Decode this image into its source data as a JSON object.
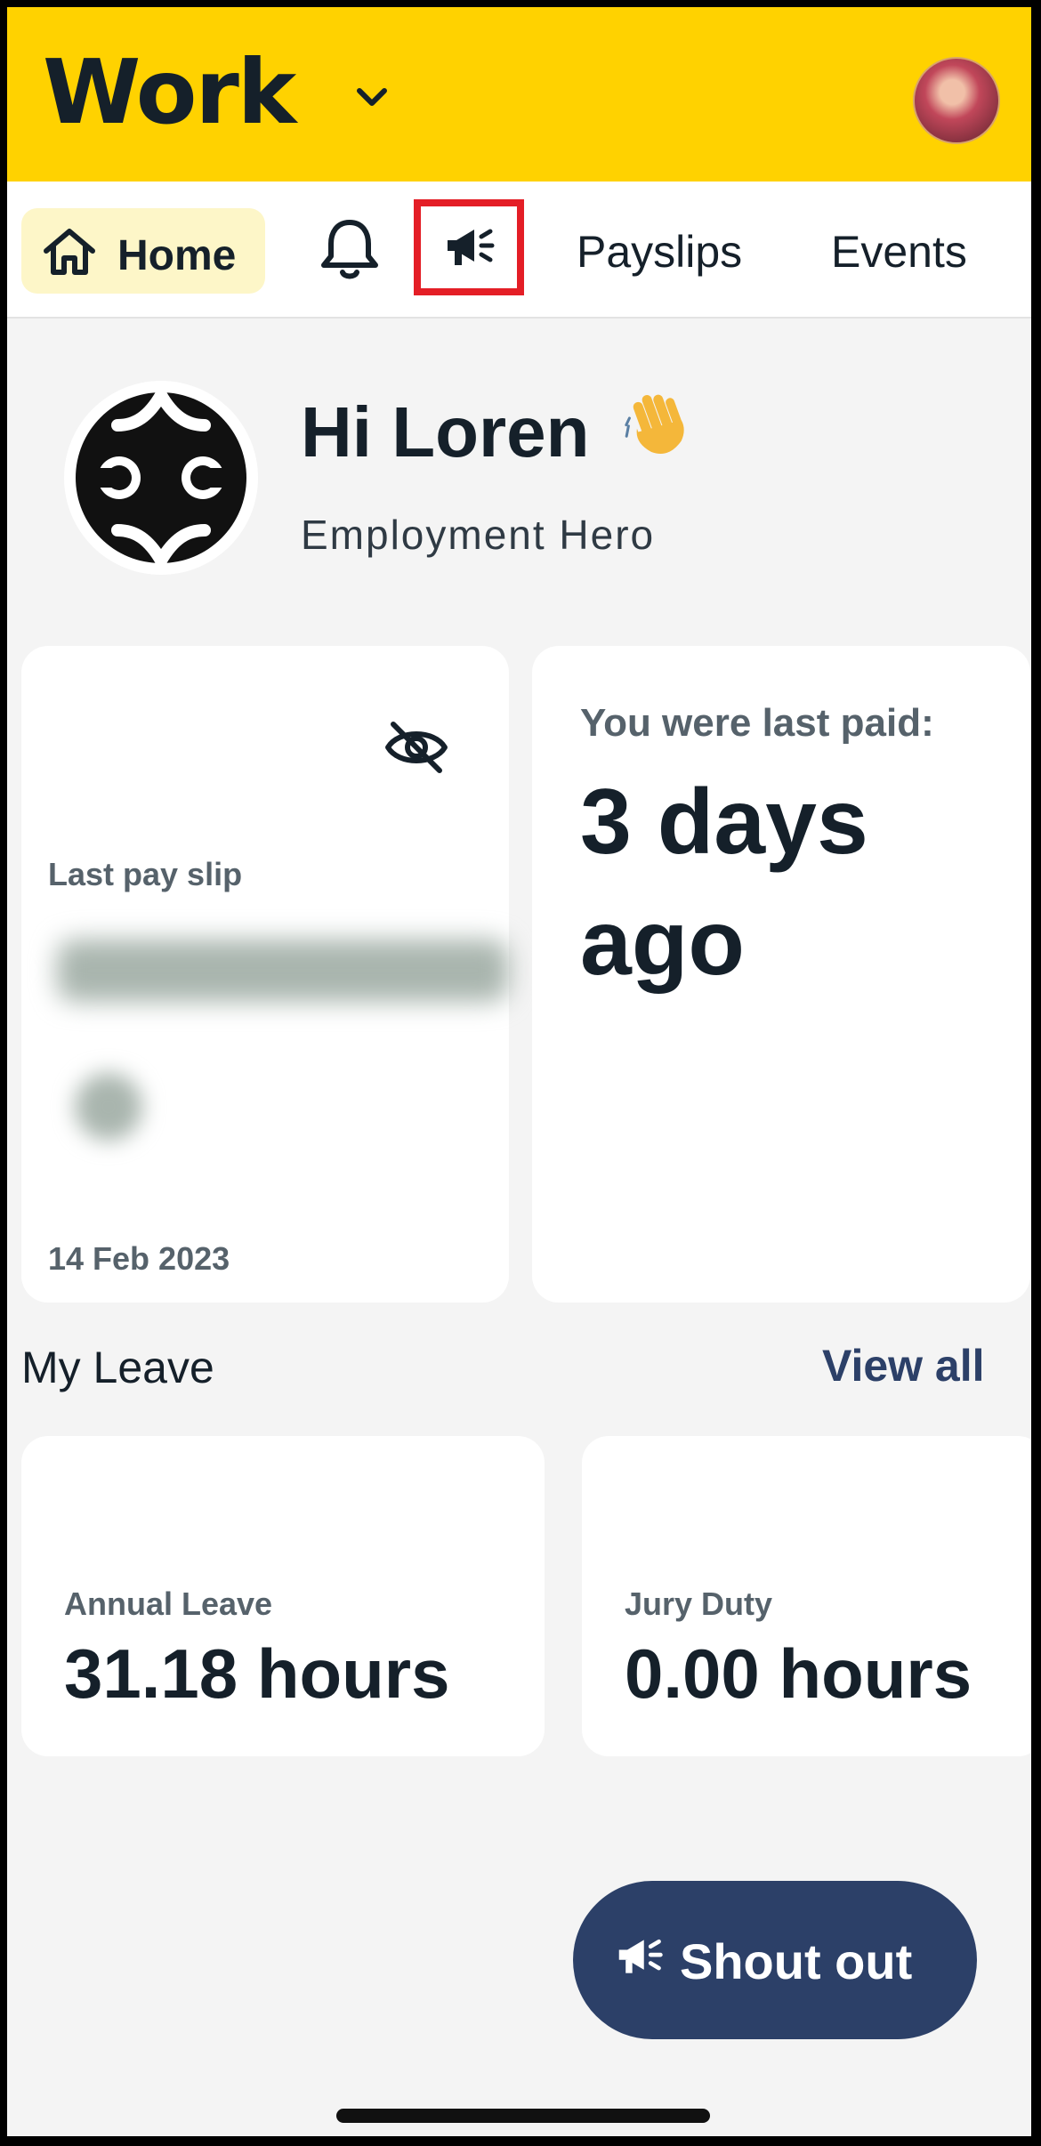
{
  "header": {
    "title": "Work",
    "accent_color": "#ffd200"
  },
  "tabs": {
    "home": "Home",
    "payslips": "Payslips",
    "events": "Events",
    "icons": [
      "home-icon",
      "bell-icon",
      "megaphone-icon"
    ]
  },
  "greeting": {
    "text": "Hi Loren",
    "emoji": "👋",
    "company": "Employment Hero"
  },
  "payslip_card": {
    "caption": "Last pay slip",
    "date": "14 Feb 2023"
  },
  "last_paid_card": {
    "label": "You were last paid:",
    "value": "3 days ago"
  },
  "leave": {
    "title": "My Leave",
    "view_all": "View all",
    "items": [
      {
        "label": "Annual Leave",
        "value": "31.18 hours"
      },
      {
        "label": "Jury Duty",
        "value": "0.00 hours"
      }
    ]
  },
  "fab": {
    "label": "Shout out",
    "color": "#2c4068"
  }
}
